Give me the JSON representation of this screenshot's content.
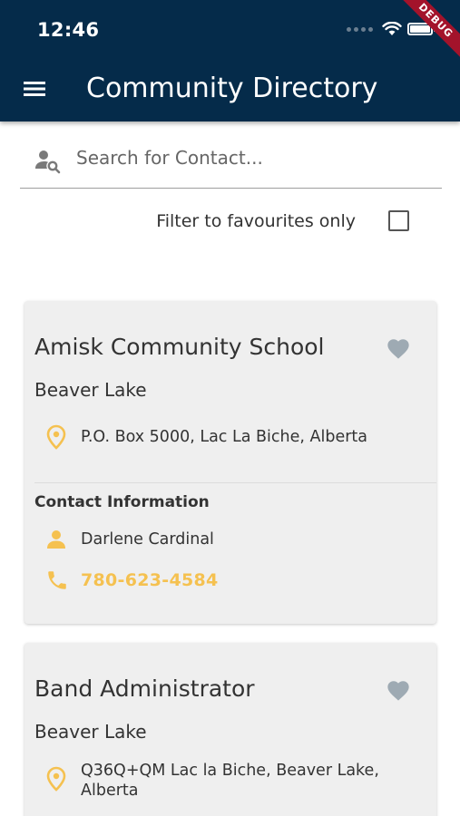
{
  "status_bar": {
    "time": "12:46"
  },
  "debug_banner": "DEBUG",
  "app_bar": {
    "title": "Community Directory"
  },
  "search": {
    "placeholder": "Search for Contact...",
    "value": ""
  },
  "filter": {
    "label": "Filter to favourites only",
    "checked": false
  },
  "colors": {
    "app_bar": "#052b4a",
    "accent": "#f5c150",
    "card": "#efefef",
    "heart": "#9eaab3"
  },
  "contacts": [
    {
      "name": "Amisk Community School",
      "community": "Beaver Lake",
      "address": "P.O. Box 5000, Lac La Biche, Alberta",
      "contact_heading": "Contact Information",
      "person": "Darlene Cardinal",
      "phone": "780-623-4584"
    },
    {
      "name": "Band Administrator",
      "community": "Beaver Lake",
      "address": "Q36Q+QM Lac la Biche, Beaver Lake, Alberta"
    }
  ]
}
